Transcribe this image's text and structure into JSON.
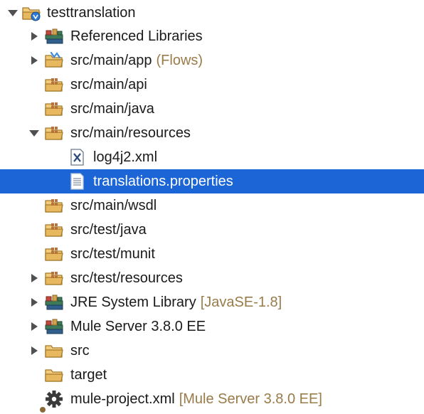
{
  "tree": {
    "project": {
      "label": "testtranslation",
      "icon": "mule-project-icon",
      "state": "expanded"
    },
    "referenced_libraries": {
      "label": "Referenced Libraries",
      "icon": "library-icon",
      "state": "collapsed"
    },
    "src_main_app": {
      "label": "src/main/app",
      "decoration": "(Flows)",
      "icon": "flows-package-icon",
      "state": "collapsed"
    },
    "src_main_api": {
      "label": "src/main/api",
      "icon": "package-folder-icon"
    },
    "src_main_java": {
      "label": "src/main/java",
      "icon": "package-folder-icon"
    },
    "src_main_resources": {
      "label": "src/main/resources",
      "icon": "package-folder-icon",
      "state": "expanded"
    },
    "log4j2": {
      "label": "log4j2.xml",
      "icon": "xml-file-icon"
    },
    "translations": {
      "label": "translations.properties",
      "icon": "text-file-icon",
      "selected": true
    },
    "src_main_wsdl": {
      "label": "src/main/wsdl",
      "icon": "package-folder-icon"
    },
    "src_test_java": {
      "label": "src/test/java",
      "icon": "package-folder-icon"
    },
    "src_test_munit": {
      "label": "src/test/munit",
      "icon": "package-folder-icon"
    },
    "src_test_resources": {
      "label": "src/test/resources",
      "icon": "package-folder-icon",
      "state": "collapsed"
    },
    "jre": {
      "label": "JRE System Library",
      "decoration": "[JavaSE-1.8]",
      "icon": "library-icon",
      "state": "collapsed"
    },
    "mule_server": {
      "label": "Mule Server 3.8.0 EE",
      "icon": "library-icon",
      "state": "collapsed"
    },
    "src": {
      "label": "src",
      "icon": "folder-icon",
      "state": "collapsed"
    },
    "target": {
      "label": "target",
      "icon": "folder-icon"
    },
    "mule_project_xml": {
      "label": "mule-project.xml",
      "decoration": "[Mule Server 3.8.0 EE]",
      "icon": "gear-icon"
    }
  },
  "colors": {
    "selection": "#1b65d6",
    "decoration": "#9a7b4a",
    "folder": "#e8b85f",
    "folder_outline": "#a47a2c"
  }
}
